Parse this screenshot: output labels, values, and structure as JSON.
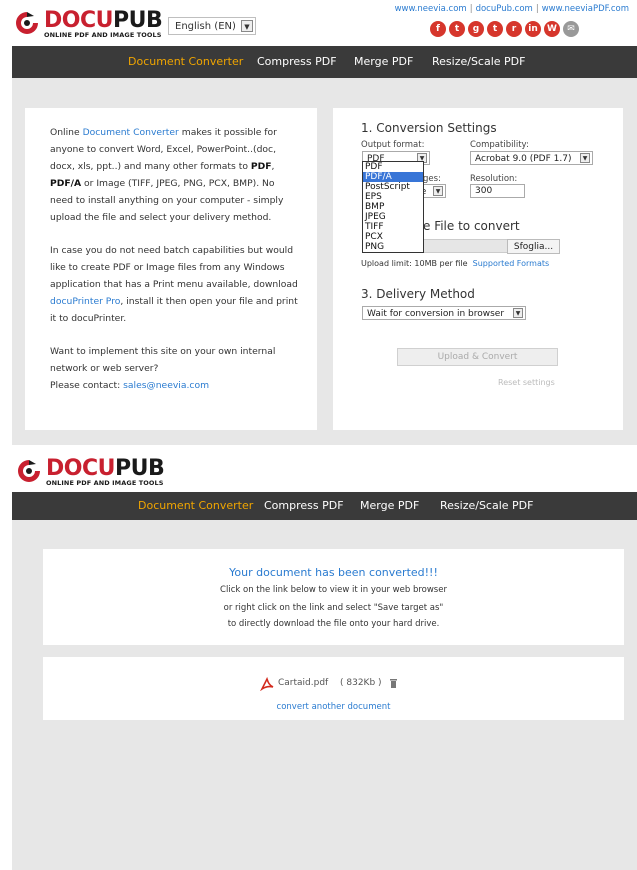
{
  "brand": {
    "name_part1": "DOCU",
    "name_part2": "PUB",
    "tagline": "ONLINE PDF AND IMAGE TOOLS"
  },
  "language_select": {
    "value": "English (EN)"
  },
  "top_links": [
    "www.neevia.com",
    "docuPub.com",
    "www.neeviaPDF.com"
  ],
  "social": [
    {
      "icon": "facebook-icon",
      "glyph": "f",
      "color": "#d6362c"
    },
    {
      "icon": "twitter-icon",
      "glyph": "t",
      "color": "#d6362c"
    },
    {
      "icon": "googleplus-icon",
      "glyph": "g",
      "color": "#d6362c"
    },
    {
      "icon": "tumblr-icon",
      "glyph": "t",
      "color": "#d6362c"
    },
    {
      "icon": "reddit-icon",
      "glyph": "r",
      "color": "#d6362c"
    },
    {
      "icon": "linkedin-icon",
      "glyph": "in",
      "color": "#d6362c"
    },
    {
      "icon": "wordpress-icon",
      "glyph": "W",
      "color": "#d6362c"
    },
    {
      "icon": "email-icon",
      "glyph": "✉",
      "color": "#999999"
    }
  ],
  "nav": [
    {
      "label": "Document Converter",
      "active": true
    },
    {
      "label": "Compress PDF",
      "active": false
    },
    {
      "label": "Merge PDF",
      "active": false
    },
    {
      "label": "Resize/Scale PDF",
      "active": false
    }
  ],
  "colors": {
    "accent": "#f0a500",
    "nav_bg": "#3a3a3a",
    "link": "#2a7bd0",
    "brand_red": "#c8202f"
  },
  "intro": {
    "p1_a": "Online ",
    "p1_link": "Document Converter",
    "p1_b": " makes it possible for anyone to convert Word, Excel, PowerPoint..(doc, docx, xls, ppt..) and many other formats to ",
    "p1_pdf": "PDF",
    "p1_c": ", ",
    "p1_pdfa": "PDF/A",
    "p1_d": " or Image (TIFF, JPEG, PNG, PCX, BMP). No need to install anything on your computer - simply upload the file and select your delivery method.",
    "p2_a": "In case you do not need batch capabilities but would like to create PDF or Image files from any Windows application that has a Print menu available, download ",
    "p2_link": "docuPrinter Pro",
    "p2_b": ", install it then open your file and print it to docuPrinter.",
    "p3_a": "Want to implement this site on your own internal network or web server?",
    "p3_b": "Please contact: ",
    "p3_email": "sales@neevia.com"
  },
  "settings": {
    "title": "1. Conversion Settings",
    "output_label": "Output format:",
    "output_value": "PDF",
    "compat_label": "Compatibility:",
    "compat_value": "Acrobat 9.0 (PDF 1.7)",
    "images_label": "ges:",
    "images_value": "ge",
    "resolution_label": "Resolution:",
    "resolution_value": "300",
    "format_options": [
      "PDF",
      "PDF/A",
      "PostScript",
      "EPS",
      "BMP",
      "JPEG",
      "TIFF",
      "PCX",
      "PNG"
    ],
    "highlighted_option": "PDF/A"
  },
  "file_section": {
    "title_visible": "e File to convert",
    "browse_label": "Sfoglia...",
    "upload_limit": "Upload limit: 10MB per file",
    "supported_link": "Supported Formats"
  },
  "delivery": {
    "title": "3. Delivery Method",
    "value": "Wait for conversion in browser"
  },
  "actions": {
    "upload": "Upload & Convert",
    "reset": "Reset settings"
  },
  "result": {
    "title": "Your document has been converted!!!",
    "line1": "Click on the link below to view it in your web browser",
    "line2": "or right click on the link and select \"Save target as\"",
    "line3": "to directly download the file onto your hard drive.",
    "file_name": "Cartaid.pdf",
    "file_size": "( 832Kb )",
    "another": "convert another document"
  }
}
